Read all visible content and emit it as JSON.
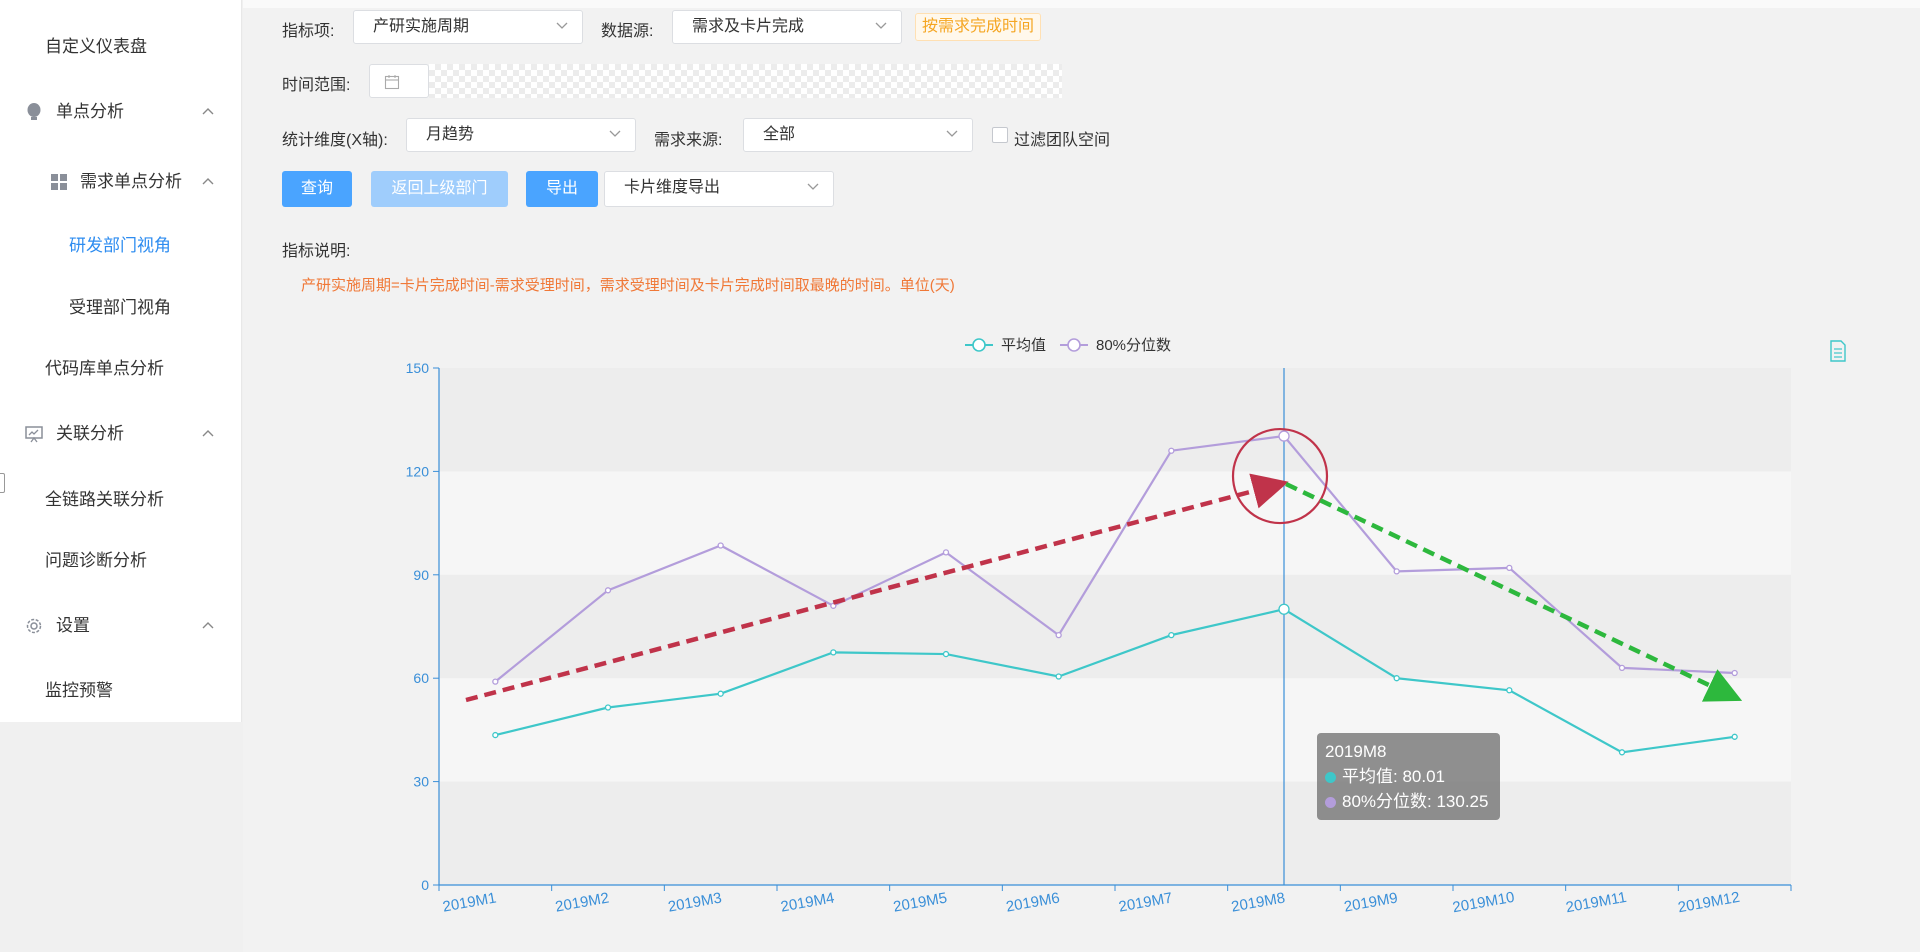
{
  "sidebar": {
    "items": [
      {
        "label": "自定义仪表盘"
      },
      {
        "label": "单点分析"
      },
      {
        "label": "需求单点分析"
      },
      {
        "label": "研发部门视角"
      },
      {
        "label": "受理部门视角"
      },
      {
        "label": "代码库单点分析"
      },
      {
        "label": "关联分析"
      },
      {
        "label": "全链路关联分析"
      },
      {
        "label": "问题诊断分析"
      },
      {
        "label": "设置"
      },
      {
        "label": "监控预警"
      }
    ]
  },
  "filters": {
    "metric_label": "指标项:",
    "metric_value": "产研实施周期",
    "source_label": "数据源:",
    "source_value": "需求及卡片完成",
    "source_tag": "按需求完成时间",
    "time_label": "时间范围:",
    "dimension_label": "统计维度(X轴):",
    "dimension_value": "月趋势",
    "origin_label": "需求来源:",
    "origin_value": "全部",
    "team_filter_label": "过滤团队空间"
  },
  "actions": {
    "query": "查询",
    "back": "返回上级部门",
    "export": "导出",
    "export_mode": "卡片维度导出"
  },
  "description": {
    "title": "指标说明:",
    "text": "产研实施周期=卡片完成时间-需求受理时间，需求受理时间及卡片完成时间取最晚的时间。单位(天)"
  },
  "colors": {
    "avg": "#3ec7c9",
    "p80": "#b39ddb",
    "axis": "#3a8fd8",
    "up_arrow": "#c0334a",
    "down_arrow": "#2db83d",
    "highlight_circle": "#c0334a"
  },
  "chart_data": {
    "type": "line",
    "categories": [
      "2019M1",
      "2019M2",
      "2019M3",
      "2019M4",
      "2019M5",
      "2019M6",
      "2019M7",
      "2019M8",
      "2019M9",
      "2019M10",
      "2019M11",
      "2019M12"
    ],
    "series": [
      {
        "name": "平均值",
        "values": [
          43.5,
          51.5,
          55.5,
          67.5,
          67,
          60.5,
          72.5,
          80.01,
          60,
          56.5,
          38.5,
          43
        ]
      },
      {
        "name": "80%分位数",
        "values": [
          59,
          85.5,
          98.5,
          81,
          96.5,
          72.5,
          126,
          130.25,
          91,
          92,
          63,
          61.5
        ]
      }
    ],
    "yticks": [
      "0",
      "30",
      "60",
      "90",
      "120",
      "150"
    ],
    "ylim": [
      0,
      150
    ],
    "legend_position": "top-center",
    "grid": "alternating bands",
    "hover": {
      "category": "2019M8",
      "lines": [
        {
          "label": "平均值: 80.01"
        },
        {
          "label": "80%分位数: 130.25"
        }
      ]
    }
  }
}
